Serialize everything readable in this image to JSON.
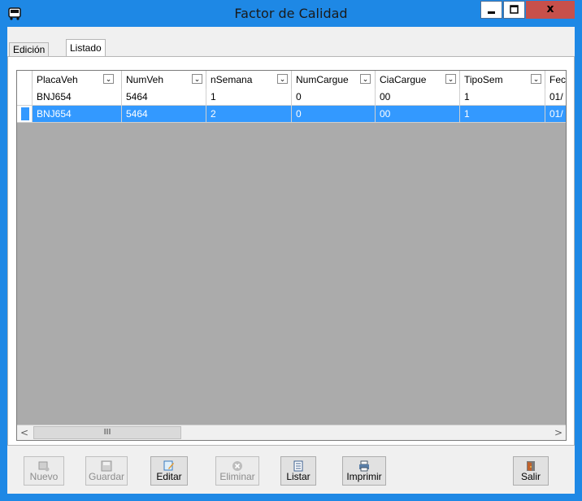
{
  "window": {
    "title": "Factor de Calidad",
    "close_symbol": "x"
  },
  "tabs": [
    {
      "label": "Edición",
      "active": false
    },
    {
      "label": "Listado",
      "active": true
    }
  ],
  "grid": {
    "columns": [
      "PlacaVeh",
      "NumVeh",
      "nSemana",
      "NumCargue",
      "CiaCargue",
      "TipoSem",
      "Fec"
    ],
    "rows": [
      [
        "BNJ654",
        "5464",
        "1",
        "0",
        "00",
        "1",
        "01/"
      ],
      [
        "BNJ654",
        "5464",
        "2",
        "0",
        "00",
        "1",
        "01/"
      ]
    ],
    "selected_row": 1,
    "dropdown_glyph": "⌄",
    "scroll_left": "<",
    "scroll_right": ">",
    "thumb_grip": "III"
  },
  "toolbar": {
    "buttons": [
      {
        "label": "Nuevo",
        "enabled": false,
        "icon": "new-record-icon"
      },
      {
        "label": "Guardar",
        "enabled": false,
        "icon": "save-icon"
      },
      {
        "label": "Editar",
        "enabled": true,
        "icon": "edit-icon"
      },
      {
        "label": "Eliminar",
        "enabled": false,
        "icon": "delete-icon"
      },
      {
        "label": "Listar",
        "enabled": true,
        "icon": "list-icon"
      },
      {
        "label": "Imprimir",
        "enabled": true,
        "icon": "printer-icon"
      },
      {
        "label": "Salir",
        "enabled": true,
        "icon": "exit-door-icon"
      }
    ]
  },
  "colors": {
    "title_bar": "#1e88e5",
    "selection": "#3399ff",
    "close_button": "#c7504b",
    "grid_empty": "#ababab"
  }
}
